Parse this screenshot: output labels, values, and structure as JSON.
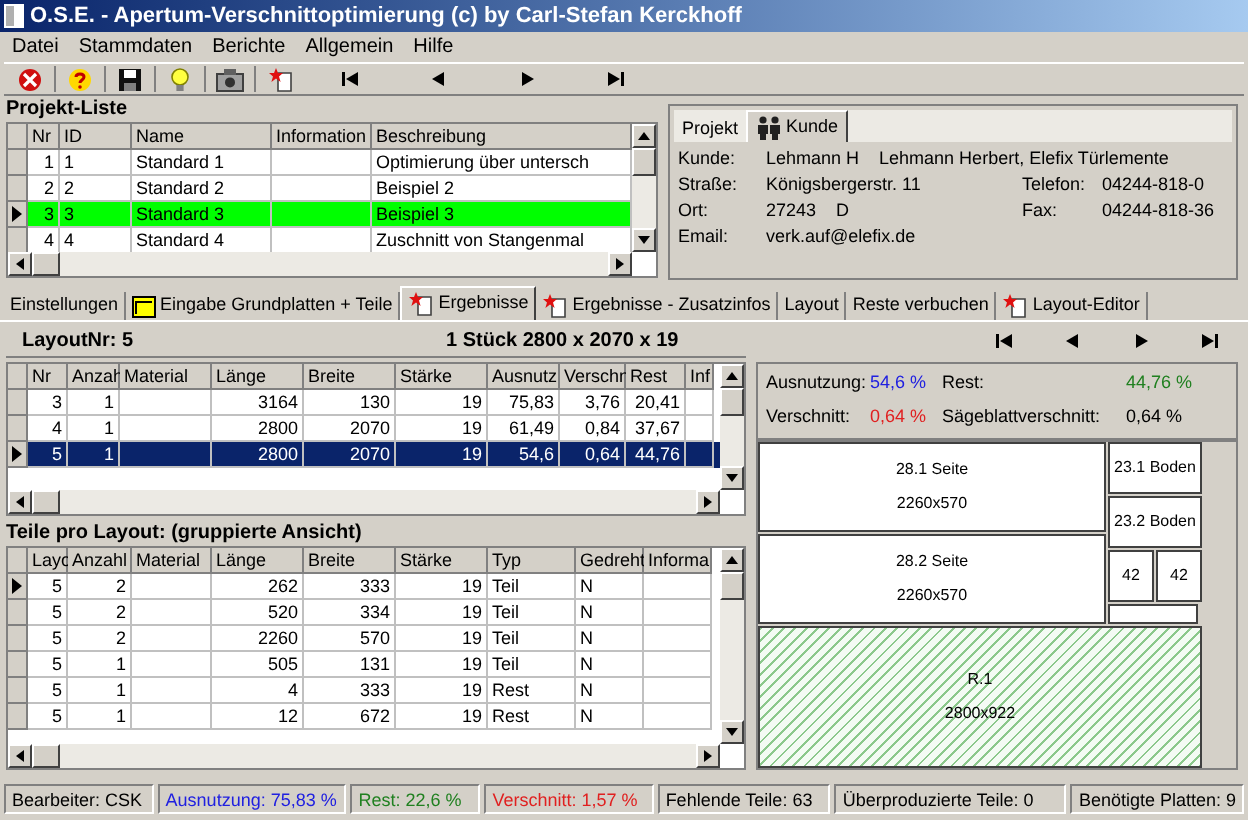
{
  "window": {
    "title": "O.S.E. - Apertum-Verschnittoptimierung (c) by Carl-Stefan Kerckhoff"
  },
  "menu": [
    "Datei",
    "Stammdaten",
    "Berichte",
    "Allgemein",
    "Hilfe"
  ],
  "project_list": {
    "title": "Projekt-Liste",
    "columns": [
      "Nr",
      "ID",
      "Name",
      "Information",
      "Beschreibung"
    ],
    "rows": [
      {
        "cells": [
          "1",
          "1",
          "Standard 1",
          null,
          "Optimierung über untersch"
        ],
        "selected": false,
        "current": false
      },
      {
        "cells": [
          "2",
          "2",
          "Standard 2",
          null,
          "Beispiel 2"
        ],
        "selected": false,
        "current": false
      },
      {
        "cells": [
          "3",
          "3",
          "Standard 3",
          null,
          "Beispiel 3"
        ],
        "selected": true,
        "current": true
      },
      {
        "cells": [
          "4",
          "4",
          "Standard 4",
          null,
          "Zuschnitt von Stangenmal"
        ],
        "selected": false,
        "current": false
      }
    ]
  },
  "customer_panel": {
    "tabs": [
      {
        "label": "Projekt",
        "selected": false,
        "kind": "plain"
      },
      {
        "label": "Kunde",
        "selected": true,
        "kind": "people"
      }
    ],
    "rows": [
      {
        "label": "Kunde:",
        "values": [
          "Lehmann H",
          "Lehmann Herbert, Elefix Türlemente"
        ]
      },
      {
        "label": "Straße:",
        "values": [
          "Königsbergerstr. 11"
        ],
        "right": {
          "label": "Telefon:",
          "value": "04244-818-0"
        }
      },
      {
        "label": "Ort:",
        "values": [
          "27243",
          "D"
        ],
        "right": {
          "label": "Fax:",
          "value": "04244-818-36"
        }
      },
      {
        "label": "Email:",
        "values": [
          "verk.auf@elefix.de"
        ]
      }
    ]
  },
  "tabs": [
    {
      "label": "Einstellungen",
      "selected": false,
      "kind": "plain"
    },
    {
      "label": "Eingabe Grundplatten + Teile",
      "selected": false,
      "kind": "frame"
    },
    {
      "label": "Ergebnisse",
      "selected": true,
      "kind": "document"
    },
    {
      "label": "Ergebnisse - Zusatzinfos",
      "selected": false,
      "kind": "document"
    },
    {
      "label": "Layout",
      "selected": false,
      "kind": "plain"
    },
    {
      "label": "Reste verbuchen",
      "selected": false,
      "kind": "plain"
    },
    {
      "label": "Layout-Editor",
      "selected": false,
      "kind": "document"
    }
  ],
  "layout_header": {
    "number": "LayoutNr: 5",
    "dimensions": "1 Stück 2800 x 2070 x 19"
  },
  "layouts_table": {
    "columns": [
      "Nr",
      "Anzah",
      "Material",
      "Länge",
      "Breite",
      "Stärke",
      "Ausnutz",
      "Verschn",
      "Rest",
      "Inf"
    ],
    "rows": [
      {
        "cells": [
          "3",
          "1",
          null,
          "3164",
          "130",
          "19",
          "75,83",
          "3,76",
          "20,41",
          null
        ],
        "selected": false,
        "current": false
      },
      {
        "cells": [
          "4",
          "1",
          null,
          "2800",
          "2070",
          "19",
          "61,49",
          "0,84",
          "37,67",
          null
        ],
        "selected": false,
        "current": false
      },
      {
        "cells": [
          "5",
          "1",
          null,
          "2800",
          "2070",
          "19",
          "54,6",
          "0,64",
          "44,76",
          null
        ],
        "selected": true,
        "current": true
      }
    ]
  },
  "parts_title": "Teile pro Layout: (gruppierte Ansicht)",
  "parts_table": {
    "columns": [
      "Layo",
      "Anzahl",
      "Material",
      "Länge",
      "Breite",
      "Stärke",
      "Typ",
      "Gedreht",
      "Informa"
    ],
    "rows": [
      {
        "cells": [
          "5",
          "2",
          null,
          "262",
          "333",
          "19",
          "Teil",
          "N",
          null
        ],
        "selected": false,
        "current": true
      },
      {
        "cells": [
          "5",
          "2",
          null,
          "520",
          "334",
          "19",
          "Teil",
          "N",
          null
        ],
        "selected": false,
        "current": false
      },
      {
        "cells": [
          "5",
          "2",
          null,
          "2260",
          "570",
          "19",
          "Teil",
          "N",
          null
        ],
        "selected": false,
        "current": false
      },
      {
        "cells": [
          "5",
          "1",
          null,
          "505",
          "131",
          "19",
          "Teil",
          "N",
          null
        ],
        "selected": false,
        "current": false
      },
      {
        "cells": [
          "5",
          "1",
          null,
          "4",
          "333",
          "19",
          "Rest",
          "N",
          null
        ],
        "selected": false,
        "current": false
      },
      {
        "cells": [
          "5",
          "1",
          null,
          "12",
          "672",
          "19",
          "Rest",
          "N",
          null
        ],
        "selected": false,
        "current": false
      }
    ]
  },
  "stats": [
    {
      "label": "Ausnutzung:",
      "value": "54,6 %",
      "color": "#2020e0"
    },
    {
      "label": "Rest:",
      "value": "44,76 %",
      "color": "#208020"
    },
    {
      "label": "Verschnitt:",
      "value": "0,64 %",
      "color": "#e02020"
    },
    {
      "label": "Sägeblattverschnitt:",
      "value": "0,64 %",
      "color": "#000000"
    }
  ],
  "layout_pieces": [
    {
      "kind": "part",
      "label": "28.1 Seite",
      "size": "2260x570"
    },
    {
      "kind": "part",
      "label": "28.2 Seite",
      "size": "2260x570"
    },
    {
      "kind": "part",
      "label": "23.1 Boden"
    },
    {
      "kind": "part",
      "label": "23.2 Boden"
    },
    {
      "kind": "part",
      "label": "42"
    },
    {
      "kind": "part",
      "label": "42"
    },
    {
      "kind": "offcut"
    },
    {
      "kind": "rest",
      "label": "R.1",
      "size": "2800x922"
    }
  ],
  "status_bar": [
    {
      "text": "Bearbeiter: CSK",
      "color": "#000000"
    },
    {
      "text": "Ausnutzung: 75,83 %",
      "color": "#2020e0"
    },
    {
      "text": "Rest: 22,6 %",
      "color": "#208020"
    },
    {
      "text": "Verschnitt: 1,57 %",
      "color": "#e02020"
    },
    {
      "text": "Fehlende Teile: 63",
      "color": "#000000"
    },
    {
      "text": "Überproduzierte Teile: 0",
      "color": "#000000"
    },
    {
      "text": "Benötigte Platten: 9",
      "color": "#000000"
    }
  ]
}
